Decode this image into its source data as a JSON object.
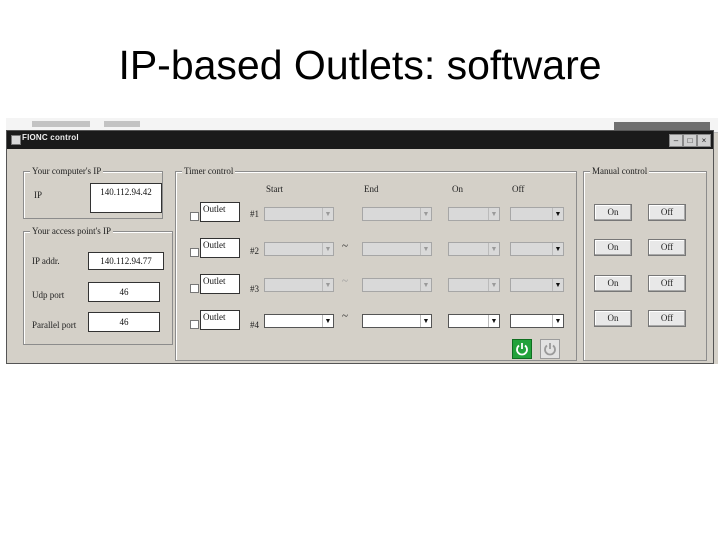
{
  "slide": {
    "title": "IP-based Outlets: software"
  },
  "window": {
    "title": "FIONC control"
  },
  "computer_ip": {
    "legend": "Your computer's IP",
    "label": "IP",
    "value": "140.112.94.42"
  },
  "access_point": {
    "legend": "Your access point's IP",
    "ip_label": "IP addr.",
    "ip_value": "140.112.94.77",
    "udp_label": "Udp port",
    "udp_value": "46",
    "parallel_label": "Parallel port",
    "parallel_value": "46"
  },
  "timer": {
    "legend": "Timer control",
    "columns": {
      "start": "Start",
      "end": "End",
      "on": "On",
      "off": "Off"
    },
    "rows": [
      {
        "name": "Outlet",
        "index": "#1",
        "separator": "~",
        "enabled": false
      },
      {
        "name": "Outlet",
        "index": "#2",
        "separator": "~",
        "enabled": false
      },
      {
        "name": "Outlet",
        "index": "#3",
        "separator": "~",
        "enabled": false
      },
      {
        "name": "Outlet",
        "index": "#4",
        "separator": "~",
        "enabled": true
      }
    ]
  },
  "manual": {
    "legend": "Manual control",
    "rows": [
      {
        "on": "On",
        "off": "Off"
      },
      {
        "on": "On",
        "off": "Off"
      },
      {
        "on": "On",
        "off": "Off"
      },
      {
        "on": "On",
        "off": "Off"
      }
    ]
  },
  "icons": {
    "power_on": "power-on-icon",
    "power_off": "power-off-icon",
    "power_on_color": "#22a23a"
  }
}
